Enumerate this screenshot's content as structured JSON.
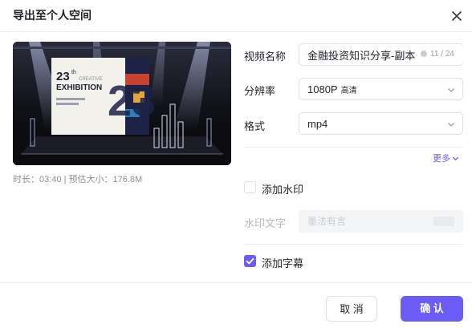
{
  "dialog": {
    "title": "导出至个人空间"
  },
  "preview": {
    "poster_line1": "23",
    "poster_sup": "th",
    "poster_line2": "CREATIVE",
    "poster_line3": "EXHIBITION",
    "poster_big": "23",
    "duration_label": "时长：",
    "duration_value": "03:40",
    "separator": " | ",
    "size_label": "预估大小：",
    "size_value": "176.8M"
  },
  "form": {
    "name_label": "视频名称",
    "name_value": "金融投资知识分享-副本",
    "name_count": "11 / 24",
    "resolution_label": "分辨率",
    "resolution_value": "1080P",
    "resolution_tag": "高清",
    "format_label": "格式",
    "format_value": "mp4",
    "more_label": "更多",
    "watermark_label": "添加水印",
    "watermark_text_label": "水印文字",
    "watermark_placeholder": "墨法有言",
    "subtitle_label": "添加字幕"
  },
  "state": {
    "watermark_checked": false,
    "subtitle_checked": true
  },
  "footer": {
    "cancel_label": "取 消",
    "confirm_label": "确 认"
  },
  "colors": {
    "accent": "#6b5cf6",
    "border": "#dcdfe6",
    "muted_text": "#8a8f99"
  }
}
